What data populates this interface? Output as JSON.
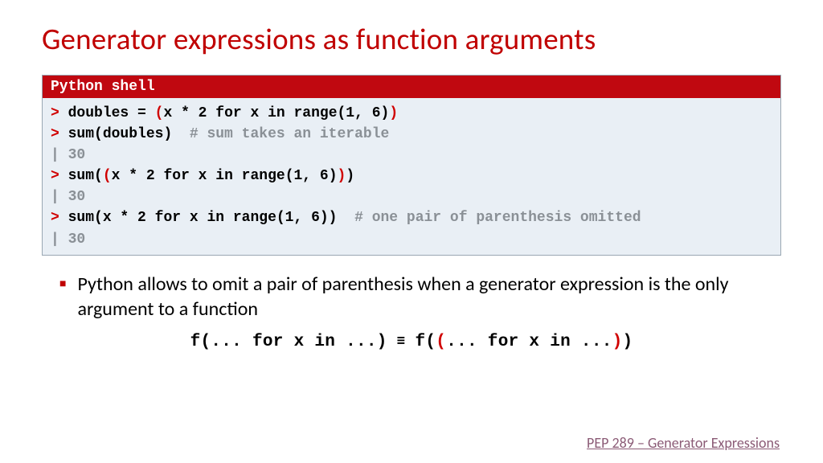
{
  "title": "Generator expressions as function arguments",
  "shell": {
    "header": "Python shell",
    "lines": {
      "l1_a": "doubles = ",
      "l1_b": "(",
      "l1_c": "x * 2 for x in range(1, 6)",
      "l1_d": ")",
      "l2_a": "sum(doubles)",
      "l2_b": "  # sum takes an iterable",
      "l3": "30",
      "l4_a": "sum(",
      "l4_b": "(",
      "l4_c": "x * 2 for x in range(1, 6)",
      "l4_d": ")",
      "l4_e": ")",
      "l5": "30",
      "l6_a": "sum(x * 2 for x in range(1, 6))",
      "l6_b": "  # one pair of parenthesis omitted",
      "l7": "30"
    }
  },
  "bullet": "Python allows to omit a pair of parenthesis when a generator expression is the only argument to a function",
  "equiv": {
    "left": "f(... for x in ...)",
    "sym": "≡",
    "r1": "f(",
    "r2": "(",
    "r3": "... for x in ...",
    "r4": ")",
    "r5": ")"
  },
  "footer": "PEP 289 – Generator Expressions",
  "prompt": ">",
  "pipe": "|"
}
